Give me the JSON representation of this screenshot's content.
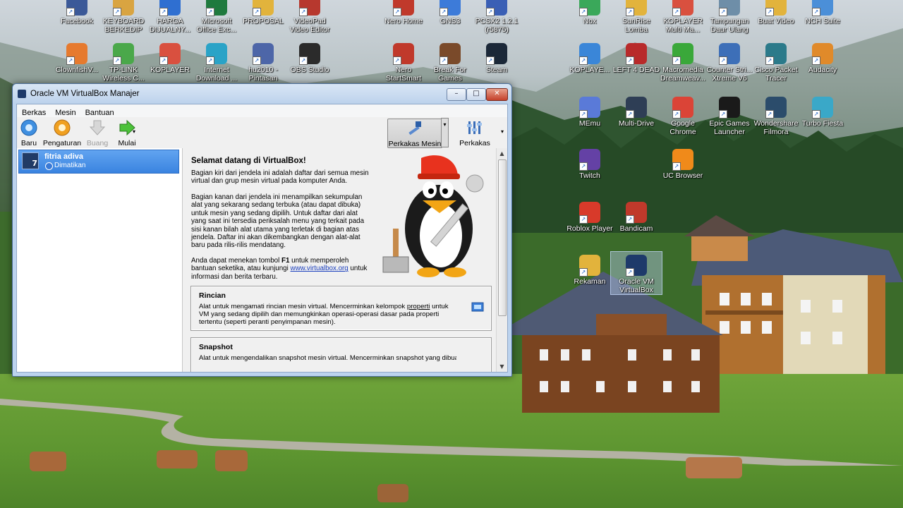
{
  "desktop": {
    "icons": [
      {
        "label": "Facebook",
        "color": "#3b5998"
      },
      {
        "label": "KEYBOARD BERKEDIP",
        "color": "#d9a441"
      },
      {
        "label": "HARGA DIJUALNY...",
        "color": "#2f6fd1"
      },
      {
        "label": "Microsoft Office Exc...",
        "color": "#1f7a3e"
      },
      {
        "label": "PROPOSAL",
        "color": "#e2b33c"
      },
      {
        "label": "VideoPad Video Editor",
        "color": "#b7382e"
      },
      {
        "label": "Nero Home",
        "color": "#c0392b"
      },
      {
        "label": "GNS3",
        "color": "#3d7bd9"
      },
      {
        "label": "PCSX2 1.2.1 (r5875)",
        "color": "#3a5fb5"
      },
      {
        "label": "Nox",
        "color": "#3aa85a"
      },
      {
        "label": "SunRise Lomba",
        "color": "#e2b33c"
      },
      {
        "label": "KOPLAYER Multi Ma...",
        "color": "#d9503f"
      },
      {
        "label": "Tampungan Daur Ulang",
        "color": "#6e8ea8"
      },
      {
        "label": "Buat Video",
        "color": "#e2b33c"
      },
      {
        "label": "NCH Suite",
        "color": "#4b8fd8"
      },
      {
        "label": "ClownfishV...",
        "color": "#e67a2e"
      },
      {
        "label": "TP-LINK Wireless C...",
        "color": "#4aa84a"
      },
      {
        "label": "KOPLAYER",
        "color": "#d9503f"
      },
      {
        "label": "Internet Download ...",
        "color": "#2aa3c7"
      },
      {
        "label": "hu2010 - Pintasan",
        "color": "#4d66a8"
      },
      {
        "label": "OBS Studio",
        "color": "#2b2b2b"
      },
      {
        "label": "Nero StartSmart",
        "color": "#c0392b"
      },
      {
        "label": "Break For Games",
        "color": "#7a4a2a"
      },
      {
        "label": "Steam",
        "color": "#1b2838"
      },
      {
        "label": "KOPLAYE...",
        "color": "#3a86d8"
      },
      {
        "label": "LEFT 4 DEAD",
        "color": "#b82a2a"
      },
      {
        "label": "Macromedia Dreamweav...",
        "color": "#3aa83a"
      },
      {
        "label": "Counter Stri... Xtreme V6",
        "color": "#3d6fb8"
      },
      {
        "label": "Cisco Packet Tracer",
        "color": "#2b7a8a"
      },
      {
        "label": "Audacity",
        "color": "#e08a2a"
      },
      {
        "label": "MEmu",
        "color": "#5a7ad8"
      },
      {
        "label": "Multi-Drive",
        "color": "#2e3e55"
      },
      {
        "label": "Google Chrome",
        "color": "#db4437"
      },
      {
        "label": "Epic Games Launcher",
        "color": "#1a1a1a"
      },
      {
        "label": "Wondershare Filmora",
        "color": "#2b4c6b"
      },
      {
        "label": "Turbo Fiesta",
        "color": "#3aa8c8"
      },
      {
        "label": "Twitch",
        "color": "#6441a5"
      },
      {
        "label": "UC Browser",
        "color": "#f08a1a"
      },
      {
        "label": "Roblox Player",
        "color": "#d83a2a"
      },
      {
        "label": "Bandicam",
        "color": "#c0392b"
      },
      {
        "label": "Rekaman",
        "color": "#e2b33c"
      },
      {
        "label": "Oracle VM VirtualBox",
        "color": "#1e3a6a"
      }
    ]
  },
  "window": {
    "title": "Oracle VM VirtualBox Manajer",
    "controls": {
      "minimize": "–",
      "maximize": "□",
      "close": "✕"
    },
    "menu": [
      "Berkas",
      "Mesin",
      "Bantuan"
    ],
    "toolbar": {
      "new_label": "Baru",
      "settings_label": "Pengaturan",
      "discard_label": "Buang",
      "start_label": "Mulai",
      "machine_tools_label": "Perkakas Mesin",
      "global_tools_label": "Perkakas Global"
    },
    "vm_list": [
      {
        "name": "fitria adiva",
        "state": "Dimatikan",
        "os_badge": "7"
      }
    ],
    "welcome": {
      "title": "Selamat datang di VirtualBox!",
      "p1": "Bagian kiri dari jendela ini adalah daftar dari semua mesin virtual dan grup mesin virtual pada komputer Anda.",
      "p2": "Bagian kanan dari jendela ini menampilkan sekumpulan alat yang sekarang sedang terbuka (atau dapat dibuka) untuk mesin yang sedang dipilih. Untuk daftar dari alat yang saat ini tersedia periksalah menu yang terkait pada sisi kanan bilah alat utama yang terletak di bagian atas jendela. Daftar ini akan dikembangkan dengan alat-alat baru pada rilis-rilis mendatang.",
      "p3_prefix": "Anda dapat menekan tombol ",
      "p3_key": "F1",
      "p3_middle": " untuk memperoleh bantuan seketika, atau kunjungi ",
      "p3_link": "www.virtualbox.org",
      "p3_suffix": " untuk informasi dan berita terbaru."
    },
    "details_box": {
      "title": "Rincian",
      "text_prefix": "Alat untuk mengamati rincian mesin virtual. Mencerminkan kelompok ",
      "text_link": "properti",
      "text_suffix": " untuk VM yang sedang dipilih dan memungkinkan operasi-operasi dasar pada properti tertentu (seperti peranti penyimpanan mesin)."
    },
    "snapshot_box": {
      "title": "Snapshot",
      "text": "Alat untuk mengendalikan snapshot mesin virtual. Mencerminkan snapshot yang dibuat"
    }
  }
}
